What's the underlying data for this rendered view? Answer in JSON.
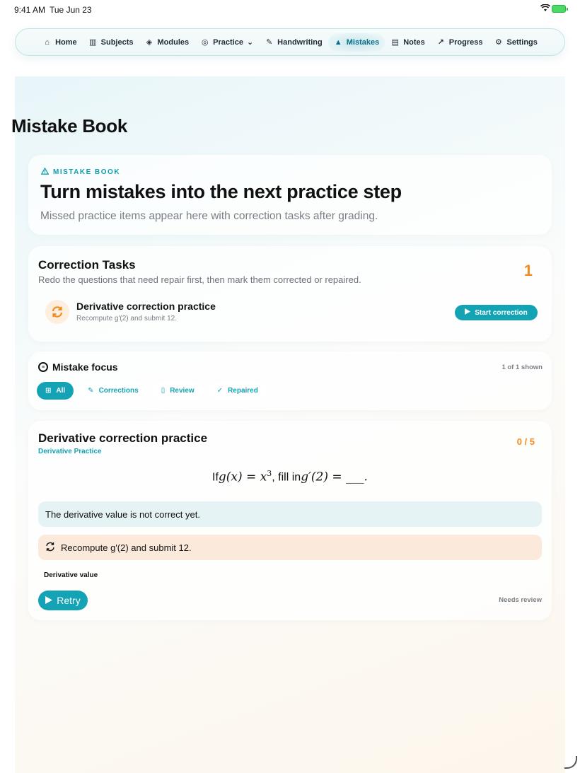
{
  "status_bar": {
    "time": "9:41 AM",
    "date": "Tue Jun 23"
  },
  "nav": {
    "items": [
      {
        "label": "Home",
        "icon": "home-icon",
        "glyph": "⌂"
      },
      {
        "label": "Subjects",
        "icon": "books-icon",
        "glyph": "▥"
      },
      {
        "label": "Modules",
        "icon": "cube-icon",
        "glyph": "◈"
      },
      {
        "label": "Practice",
        "icon": "compass-icon",
        "glyph": "◎"
      },
      {
        "label": "Handwriting",
        "icon": "pen-icon",
        "glyph": "✎"
      },
      {
        "label": "Mistakes",
        "icon": "warning-icon",
        "glyph": "▲"
      },
      {
        "label": "Notes",
        "icon": "note-icon",
        "glyph": "▤"
      },
      {
        "label": "Progress",
        "icon": "chart-icon",
        "glyph": "↗"
      },
      {
        "label": "Settings",
        "icon": "gear-icon",
        "glyph": "⚙"
      }
    ],
    "practice_caret": "⌄",
    "active": "Mistakes"
  },
  "page": {
    "title": "Mistake Book"
  },
  "hero": {
    "eyebrow": "MISTAKE BOOK",
    "headline": "Turn mistakes into the next practice step",
    "sub": "Missed practice items appear here with correction tasks after grading."
  },
  "tasks": {
    "title": "Correction Tasks",
    "desc": "Redo the questions that need repair first, then mark them corrected or repaired.",
    "count": "1",
    "items": [
      {
        "title": "Derivative correction practice",
        "sub": "Recompute g'(2) and submit 12.",
        "button": "Start correction"
      }
    ]
  },
  "focus": {
    "title": "Mistake focus",
    "shown": "1 of 1 shown",
    "chips": [
      {
        "label": "All",
        "icon": "grid-icon",
        "glyph": "⊞"
      },
      {
        "label": "Corrections",
        "icon": "edit-icon",
        "glyph": "✎"
      },
      {
        "label": "Review",
        "icon": "book-icon",
        "glyph": "▯"
      },
      {
        "label": "Repaired",
        "icon": "check-badge-icon",
        "glyph": "✓"
      }
    ]
  },
  "question": {
    "title": "Derivative correction practice",
    "subject": "Derivative Practice",
    "score": "0 / 5",
    "formula": {
      "prefix": "If",
      "lhs": "g(x) = x",
      "exp": "3",
      "middle": ", fill in",
      "rhs": "g′(2) = ___."
    },
    "feedback": "The derivative value is not correct yet.",
    "hint": "Recompute g'(2) and submit 12.",
    "field_label": "Derivative value",
    "retry": "Retry",
    "status": "Needs review"
  },
  "colors": {
    "accent": "#14a3b5",
    "warning": "#f08c1e"
  }
}
